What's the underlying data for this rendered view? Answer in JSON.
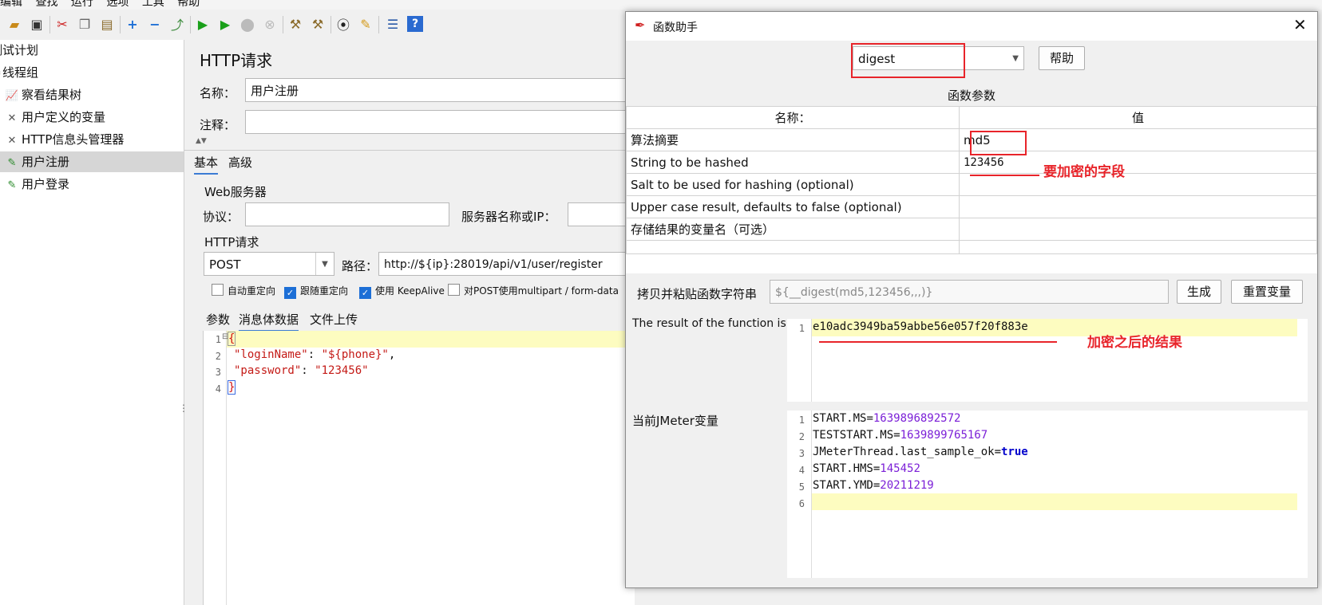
{
  "menubar": {
    "items": [
      "编辑",
      "查找",
      "运行",
      "选项",
      "工具",
      "帮助"
    ]
  },
  "toolbar": {
    "icons": [
      "open-icon",
      "save-icon",
      "cut-icon",
      "copy-icon",
      "paste-icon",
      "expand-icon",
      "collapse-icon",
      "toggle-icon",
      "start-icon",
      "start-no-pause-icon",
      "stop-icon",
      "shutdown-icon",
      "clear-icon",
      "clear-all-icon",
      "search-icon",
      "reset-search-icon",
      "function-helper-icon",
      "help-icon"
    ]
  },
  "tree": {
    "items": [
      {
        "label": "测试计划",
        "icon": "test-plan-icon"
      },
      {
        "label": "线程组",
        "icon": "thread-group-icon"
      },
      {
        "label": "察看结果树",
        "icon": "result-tree-icon"
      },
      {
        "label": "用户定义的变量",
        "icon": "wrench-icon"
      },
      {
        "label": "HTTP信息头管理器",
        "icon": "wrench-icon"
      },
      {
        "label": "用户注册",
        "icon": "sampler-icon"
      },
      {
        "label": "用户登录",
        "icon": "sampler-icon"
      }
    ]
  },
  "main": {
    "title": "HTTP请求",
    "name_label": "名称：",
    "name_value": "用户注册",
    "comment_label": "注释：",
    "tabs": [
      "基本",
      "高级"
    ],
    "web_server_label": "Web服务器",
    "protocol_label": "协议：",
    "server_label": "服务器名称或IP：",
    "http_request_label": "HTTP请求",
    "method": "POST",
    "path_label": "路径：",
    "path_value": "http://${ip}:28019/api/v1/user/register",
    "checkboxes": [
      {
        "label": "自动重定向",
        "checked": false
      },
      {
        "label": "跟随重定向",
        "checked": true
      },
      {
        "label": "使用 KeepAlive",
        "checked": true
      },
      {
        "label": "对POST使用multipart / form-data",
        "checked": false
      }
    ],
    "body_tabs": [
      "参数",
      "消息体数据",
      "文件上传"
    ],
    "body_lines": [
      {
        "n": "1",
        "text": "{"
      },
      {
        "n": "2",
        "key": "\"loginName\"",
        "sep": ": ",
        "val": "\"${phone}\"",
        "end": ","
      },
      {
        "n": "3",
        "key": "\"password\"",
        "sep": ": ",
        "val": "\"123456\"",
        "end": ""
      },
      {
        "n": "4",
        "text": "}"
      }
    ]
  },
  "dialog": {
    "title": "函数助手",
    "function": "digest",
    "help_button": "帮助",
    "params_title": "函数参数",
    "col_name": "名称：",
    "col_value": "值",
    "params": [
      {
        "name": "算法摘要",
        "value": "md5"
      },
      {
        "name": "String to be hashed",
        "value": "123456"
      },
      {
        "name": "Salt to be used for hashing (optional)",
        "value": ""
      },
      {
        "name": "Upper case result, defaults to false (optional)",
        "value": ""
      },
      {
        "name": "存储结果的变量名（可选）",
        "value": ""
      }
    ],
    "copy_label": "拷贝并粘贴函数字符串",
    "function_string": "${__digest(md5,123456,,,)}",
    "generate_button": "生成",
    "reset_button": "重置变量",
    "result_label": "The result of the function is",
    "result_line_no": "1",
    "result_value": "e10adc3949ba59abbe56e057f20f883e",
    "vars_label": "当前JMeter变量",
    "vars": [
      {
        "n": "1",
        "key": "START.MS",
        "val": "1639896892572"
      },
      {
        "n": "2",
        "key": "TESTSTART.MS",
        "val": "1639899765167"
      },
      {
        "n": "3",
        "key": "JMeterThread.last_sample_ok",
        "val": "true"
      },
      {
        "n": "4",
        "key": "START.HMS",
        "val": "145452"
      },
      {
        "n": "5",
        "key": "START.YMD",
        "val": "20211219"
      },
      {
        "n": "6",
        "key": "",
        "val": ""
      }
    ],
    "annotation_field": "要加密的字段",
    "annotation_result": "加密之后的结果"
  }
}
